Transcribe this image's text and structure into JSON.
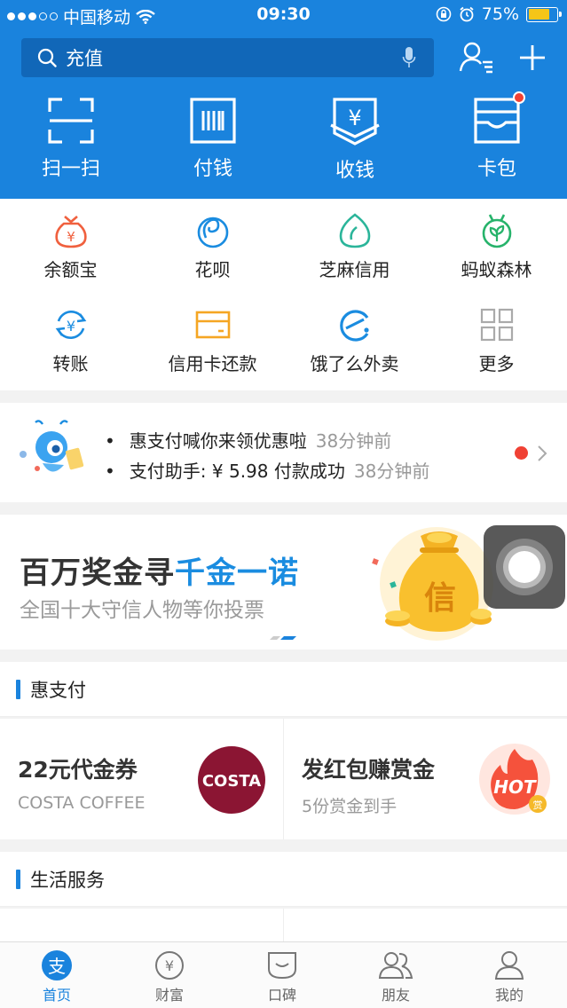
{
  "status_bar": {
    "carrier": "中国移动",
    "time": "09:30",
    "battery": "75%"
  },
  "search": {
    "placeholder": "充值"
  },
  "quick_actions": [
    {
      "label": "扫一扫",
      "icon": "scan-icon"
    },
    {
      "label": "付钱",
      "icon": "barcode-pay-icon"
    },
    {
      "label": "收钱",
      "icon": "receive-money-icon"
    },
    {
      "label": "卡包",
      "icon": "card-wallet-icon"
    }
  ],
  "apps": [
    {
      "label": "余额宝",
      "icon": "money-bag-icon",
      "color": "#f0603e"
    },
    {
      "label": "花呗",
      "icon": "huabei-icon",
      "color": "#1a8ce0"
    },
    {
      "label": "芝麻信用",
      "icon": "sesame-credit-icon",
      "color": "#2bb59a"
    },
    {
      "label": "蚂蚁森林",
      "icon": "ant-forest-icon",
      "color": "#27b36b"
    },
    {
      "label": "转账",
      "icon": "transfer-icon",
      "color": "#1a8ce0"
    },
    {
      "label": "信用卡还款",
      "icon": "credit-card-icon",
      "color": "#f5a623"
    },
    {
      "label": "饿了么外卖",
      "icon": "eleme-icon",
      "color": "#1a8ce0"
    },
    {
      "label": "更多",
      "icon": "more-grid-icon",
      "color": "#999999"
    }
  ],
  "messages": [
    {
      "text": "惠支付喊你来领优惠啦",
      "ago": "38分钟前"
    },
    {
      "text": "支付助手: ¥ 5.98 付款成功",
      "ago": "38分钟前"
    }
  ],
  "banner": {
    "title_main": "百万奖金寻",
    "title_highlight": "千金一诺",
    "subtitle": "全国十大守信人物等你投票",
    "bag_char": "信"
  },
  "sections": {
    "hui_zhifu": "惠支付",
    "life_services": "生活服务"
  },
  "deals": [
    {
      "title": "22元代金券",
      "subtitle": "COSTA COFFEE",
      "logo_text": "COSTA"
    },
    {
      "title": "发红包赚赏金",
      "subtitle": "5份赏金到手",
      "logo_text": "HOT",
      "badge": "赏"
    }
  ],
  "tabs": [
    {
      "label": "首页",
      "icon": "alipay-home-icon",
      "active": true
    },
    {
      "label": "财富",
      "icon": "wealth-icon",
      "active": false
    },
    {
      "label": "口碑",
      "icon": "koubei-icon",
      "active": false
    },
    {
      "label": "朋友",
      "icon": "friends-icon",
      "active": false
    },
    {
      "label": "我的",
      "icon": "profile-icon",
      "active": false
    }
  ],
  "colors": {
    "brand_blue": "#1a83dd",
    "search_bg": "#1167b8",
    "notify_red": "#f04134"
  }
}
